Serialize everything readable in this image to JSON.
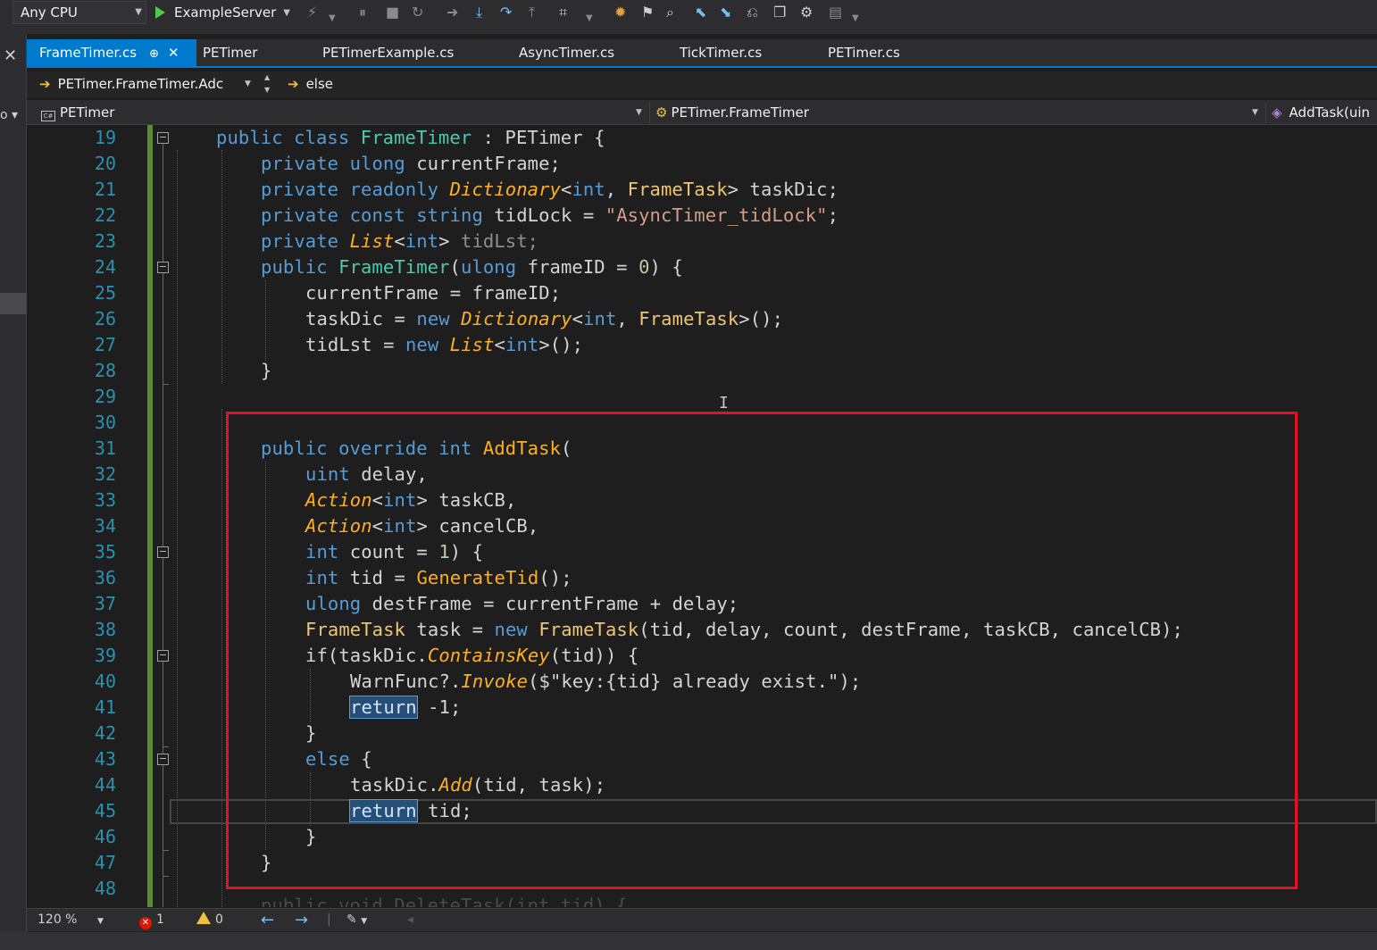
{
  "toolbar": {
    "config": "Any CPU",
    "startup_project": "ExampleServer"
  },
  "tabs": [
    {
      "label": "FrameTimer.cs",
      "pin": "⊕",
      "close": "✕"
    },
    {
      "label": "PETimer"
    },
    {
      "label": "PETimerExample.cs"
    },
    {
      "label": "AsyncTimer.cs"
    },
    {
      "label": "TickTimer.cs"
    },
    {
      "label": "PETimer.cs"
    }
  ],
  "nav": {
    "scope": "PETimer.FrameTimer.Adc",
    "breadcrumb": "else",
    "project": "PETimer",
    "type": "PETimer.FrameTimer",
    "member": "AddTask(uin"
  },
  "editor": {
    "line_numbers": [
      "19",
      "20",
      "21",
      "22",
      "23",
      "24",
      "25",
      "26",
      "27",
      "28",
      "29",
      "30",
      "31",
      "32",
      "33",
      "34",
      "35",
      "36",
      "37",
      "38",
      "39",
      "40",
      "41",
      "42",
      "43",
      "44",
      "45",
      "46",
      "47",
      "48"
    ],
    "code": {
      "l19": [
        "public",
        "class",
        "FrameTimer",
        ": PETimer {"
      ],
      "l20": [
        "private",
        "ulong",
        "currentFrame;"
      ],
      "l21": [
        "private",
        "readonly",
        "Dictionary",
        "<",
        "int",
        ", ",
        "FrameTask",
        "> taskDic;"
      ],
      "l22": [
        "private",
        "const",
        "string",
        "tidLock = ",
        "\"AsyncTimer_tidLock\"",
        ";"
      ],
      "l23": [
        "private",
        "List",
        "<",
        "int",
        "> ",
        "tidLst;"
      ],
      "l24": [
        "public",
        "FrameTimer",
        "(",
        "ulong",
        " frameID = ",
        "0",
        ") {"
      ],
      "l25": [
        "currentFrame = frameID;"
      ],
      "l26": [
        "taskDic = ",
        "new",
        "Dictionary",
        "<",
        "int",
        ", ",
        "FrameTask",
        ">();"
      ],
      "l27": [
        "tidLst = ",
        "new",
        "List",
        "<",
        "int",
        ">();"
      ],
      "l28": [
        "}"
      ],
      "l31": [
        "public",
        "override",
        "int",
        "AddTask",
        "("
      ],
      "l32": [
        "uint",
        " delay,"
      ],
      "l33": [
        "Action",
        "<",
        "int",
        "> taskCB,"
      ],
      "l34": [
        "Action",
        "<",
        "int",
        "> cancelCB,"
      ],
      "l35": [
        "int",
        " count = ",
        "1",
        ") {"
      ],
      "l36": [
        "int",
        " tid = ",
        "GenerateTid",
        "();"
      ],
      "l37": [
        "ulong",
        " destFrame = currentFrame + delay;"
      ],
      "l38": [
        "FrameTask",
        " task = ",
        "new",
        "FrameTask",
        "(tid, delay, count, destFrame, taskCB, cancelCB);"
      ],
      "l39": [
        "if(taskDic.",
        "ContainsKey",
        "(tid)) {"
      ],
      "l40": [
        "WarnFunc?.",
        "Invoke",
        "($\"key:{tid} already exist.\");"
      ],
      "l41": [
        "return",
        " -1;"
      ],
      "l42": [
        "}"
      ],
      "l43": [
        "else",
        " {"
      ],
      "l44": [
        "taskDic.",
        "Add",
        "(tid, task);"
      ],
      "l45": [
        "return",
        " tid;"
      ],
      "l46": [
        "}"
      ],
      "l47": [
        "}"
      ],
      "l49": [
        "public void DeleteTask(int tid) {"
      ]
    }
  },
  "bottombar": {
    "zoom": "120 %",
    "errors": "1",
    "warnings": "0"
  },
  "colors": {
    "accent": "#007acc",
    "highlight_box": "#e81123",
    "keyword": "#569cd6",
    "type": "#4ec9b0",
    "line_number": "#2b91af"
  }
}
